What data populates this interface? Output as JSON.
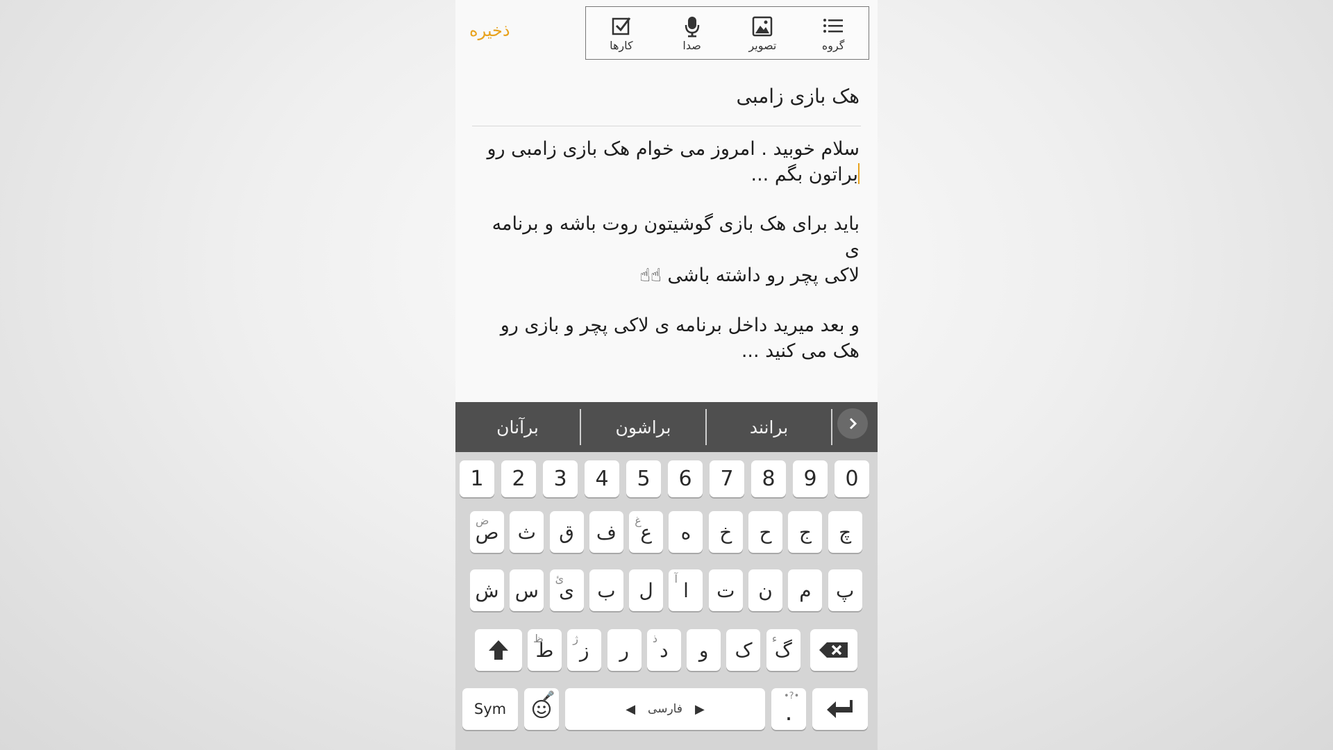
{
  "header": {
    "save_label": "ذخیره",
    "toolbar": [
      {
        "label": "کارها",
        "icon": "checkbox-icon"
      },
      {
        "label": "صدا",
        "icon": "microphone-icon"
      },
      {
        "label": "تصویر",
        "icon": "image-icon"
      },
      {
        "label": "گروه",
        "icon": "list-icon"
      }
    ]
  },
  "note": {
    "title": "هک بازی زامبی",
    "paragraphs": [
      {
        "line1": "سلام خوبید . امروز می خوام هک بازی زامبی رو",
        "line2": "براتون بگم ..."
      },
      {
        "line1": "باید برای هک بازی گوشیتون روت باشه و برنامه ی",
        "line2": "لاکی پچر رو داشته باشی",
        "emoji": "☝☝"
      },
      {
        "line1": "و بعد میرید داخل برنامه ی لاکی پچر و بازی رو",
        "line2": "هک می کنید ..."
      }
    ]
  },
  "suggestions": [
    "برآنان",
    "براشون",
    "برانند"
  ],
  "keyboard": {
    "numbers": [
      "1",
      "2",
      "3",
      "4",
      "5",
      "6",
      "7",
      "8",
      "9",
      "0"
    ],
    "row1": [
      {
        "main": "ص",
        "sub": "ض"
      },
      {
        "main": "ث",
        "sub": ""
      },
      {
        "main": "ق",
        "sub": ""
      },
      {
        "main": "ف",
        "sub": ""
      },
      {
        "main": "ع",
        "sub": "غ"
      },
      {
        "main": "ه",
        "sub": ""
      },
      {
        "main": "خ",
        "sub": ""
      },
      {
        "main": "ح",
        "sub": ""
      },
      {
        "main": "ج",
        "sub": ""
      },
      {
        "main": "چ",
        "sub": ""
      }
    ],
    "row2": [
      {
        "main": "ش",
        "sub": ""
      },
      {
        "main": "س",
        "sub": ""
      },
      {
        "main": "ی",
        "sub": "ئ"
      },
      {
        "main": "ب",
        "sub": ""
      },
      {
        "main": "ل",
        "sub": ""
      },
      {
        "main": "ا",
        "sub": "آ"
      },
      {
        "main": "ت",
        "sub": ""
      },
      {
        "main": "ن",
        "sub": ""
      },
      {
        "main": "م",
        "sub": ""
      },
      {
        "main": "پ",
        "sub": ""
      }
    ],
    "row3": [
      {
        "main": "ط",
        "sub": "ظ"
      },
      {
        "main": "ز",
        "sub": "ژ"
      },
      {
        "main": "ر",
        "sub": ""
      },
      {
        "main": "د",
        "sub": "ذ"
      },
      {
        "main": "و",
        "sub": ""
      },
      {
        "main": "ک",
        "sub": ""
      },
      {
        "main": "گ",
        "sub": "ء"
      }
    ],
    "sym_label": "Sym",
    "space_label": "فارسی",
    "period_label": ".",
    "period_sub": "•?•"
  },
  "colors": {
    "accent": "#e8a21d",
    "suggestion_bar": "#4f4f4f",
    "keyboard_bg": "#d5d5d5"
  }
}
